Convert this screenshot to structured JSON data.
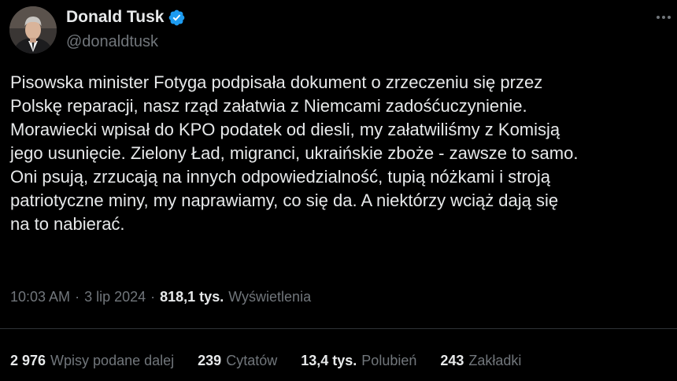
{
  "author": {
    "name": "Donald Tusk",
    "handle": "@donaldtusk",
    "verified_icon": "verified-badge-icon",
    "verified_color": "#1d9bf0"
  },
  "tweet": {
    "text": "Pisowska minister Fotyga podpisała dokument o zrzeczeniu się przez\nPolskę reparacji, nasz rząd załatwia z  Niemcami zadośćuczynienie.\nMorawiecki wpisał do KPO podatek od diesli, my załatwiliśmy z Komisją\njego usunięcie. Zielony Ład, migranci, ukraińskie zboże - zawsze to samo.\nOni psują, zrzucają na innych odpowiedzialność, tupią nóżkami i stroją\npatriotyczne miny, my naprawiamy, co się da. A niektórzy wciąż dają się\nna to nabierać."
  },
  "meta": {
    "time": "10:03 AM",
    "separator": "·",
    "date": "3 lip 2024",
    "views_count": "818,1 tys.",
    "views_label": "Wyświetlenia"
  },
  "stats": {
    "reposts": {
      "count": "2 976",
      "label": "Wpisy podane dalej"
    },
    "quotes": {
      "count": "239",
      "label": "Cytatów"
    },
    "likes": {
      "count": "13,4 tys.",
      "label": "Polubień"
    },
    "bookmarks": {
      "count": "243",
      "label": "Zakładki"
    }
  },
  "colors": {
    "background": "#000000",
    "text_primary": "#e7e9ea",
    "text_secondary": "#71767b",
    "divider": "#2f3336"
  }
}
